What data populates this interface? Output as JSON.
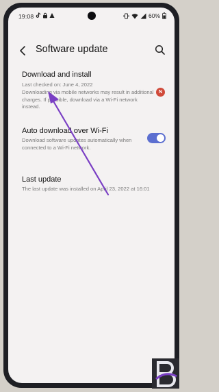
{
  "statusbar": {
    "time": "19:08",
    "battery": "60%"
  },
  "header": {
    "title": "Software update"
  },
  "items": [
    {
      "title": "Download and install",
      "subtitle": "Last checked on: June 4, 2022",
      "detail": "Downloading via mobile networks may result in additional charges. If possible, download via a Wi-Fi network instead.",
      "badge": "N"
    },
    {
      "title": "Auto download over Wi-Fi",
      "detail": "Download software updates automatically when connected to a Wi-Fi network.",
      "toggle_on": true
    },
    {
      "title": "Last update",
      "detail": "The last update was installed on April 23, 2022 at 16:01"
    }
  ],
  "colors": {
    "accent": "#5c6fd0",
    "badge": "#d04a3a",
    "annotation_arrow": "#7a3fc4"
  },
  "icons": [
    "back-arrow-icon",
    "search-icon",
    "wifi-icon",
    "signal-icon",
    "battery-icon",
    "watermark-logo"
  ]
}
